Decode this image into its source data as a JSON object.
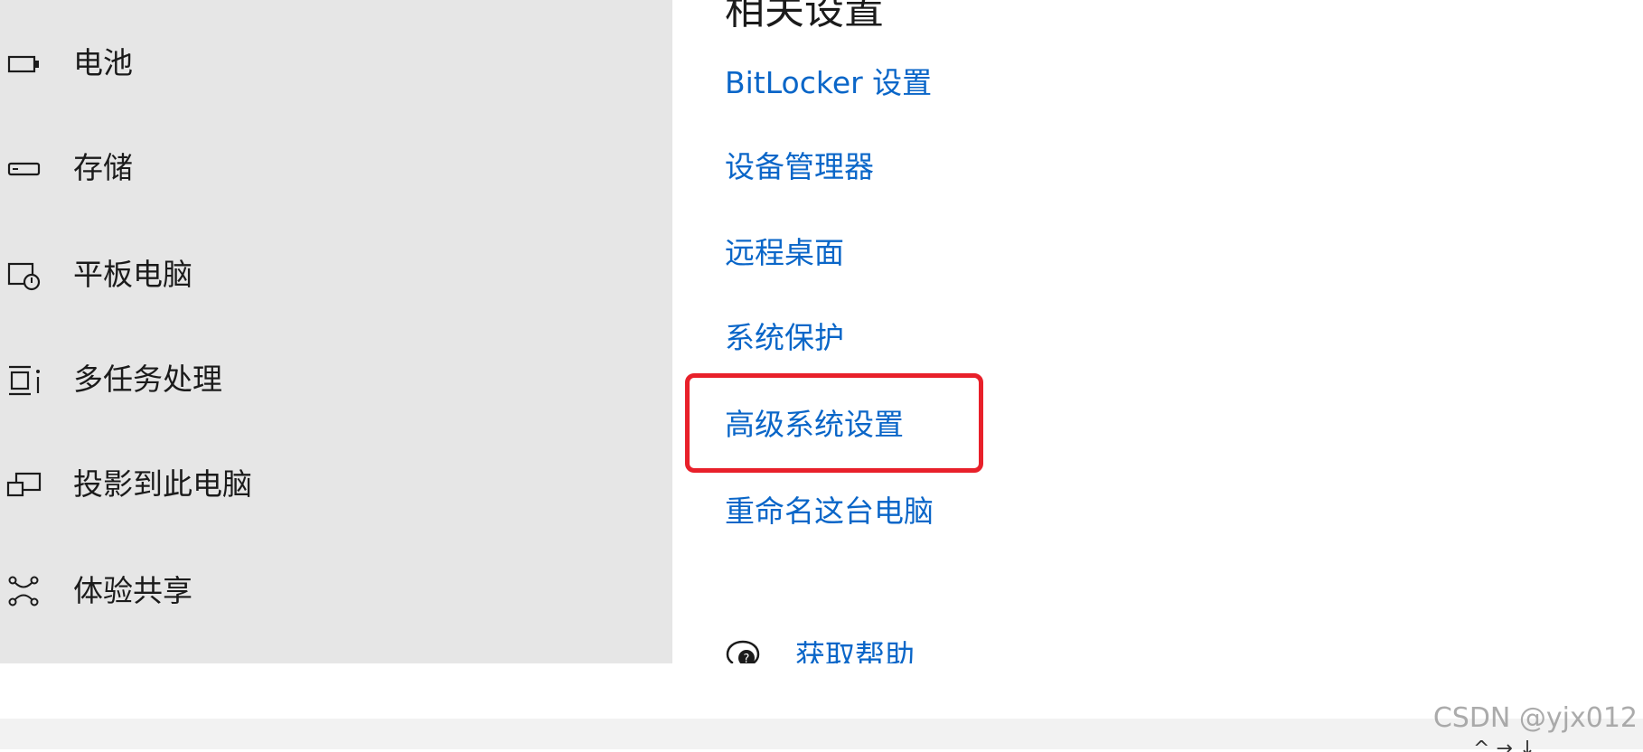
{
  "sidebar": {
    "items": [
      {
        "label": "电池",
        "icon": "battery-icon"
      },
      {
        "label": "存储",
        "icon": "storage-icon"
      },
      {
        "label": "平板电脑",
        "icon": "tablet-icon"
      },
      {
        "label": "多任务处理",
        "icon": "multitasking-icon"
      },
      {
        "label": "投影到此电脑",
        "icon": "project-to-pc-icon"
      },
      {
        "label": "体验共享",
        "icon": "shared-experiences-icon"
      }
    ]
  },
  "related_settings": {
    "title": "相关设置",
    "links": [
      {
        "label": "BitLocker 设置"
      },
      {
        "label": "设备管理器"
      },
      {
        "label": "远程桌面"
      },
      {
        "label": "系统保护"
      },
      {
        "label": "高级系统设置"
      },
      {
        "label": "重命名这台电脑"
      }
    ],
    "highlighted_link": "高级系统设置",
    "highlight_color": "#e8202a"
  },
  "help": {
    "label": "获取帮助",
    "icon": "help-chat-icon"
  },
  "bottom_bar": {
    "controls": "^ → ↓"
  },
  "watermark": {
    "text": "CSDN @yjx012"
  },
  "colors": {
    "sidebar_background": "#e6e6e6",
    "link": "#0a66c8",
    "text": "#1b1b1b"
  }
}
